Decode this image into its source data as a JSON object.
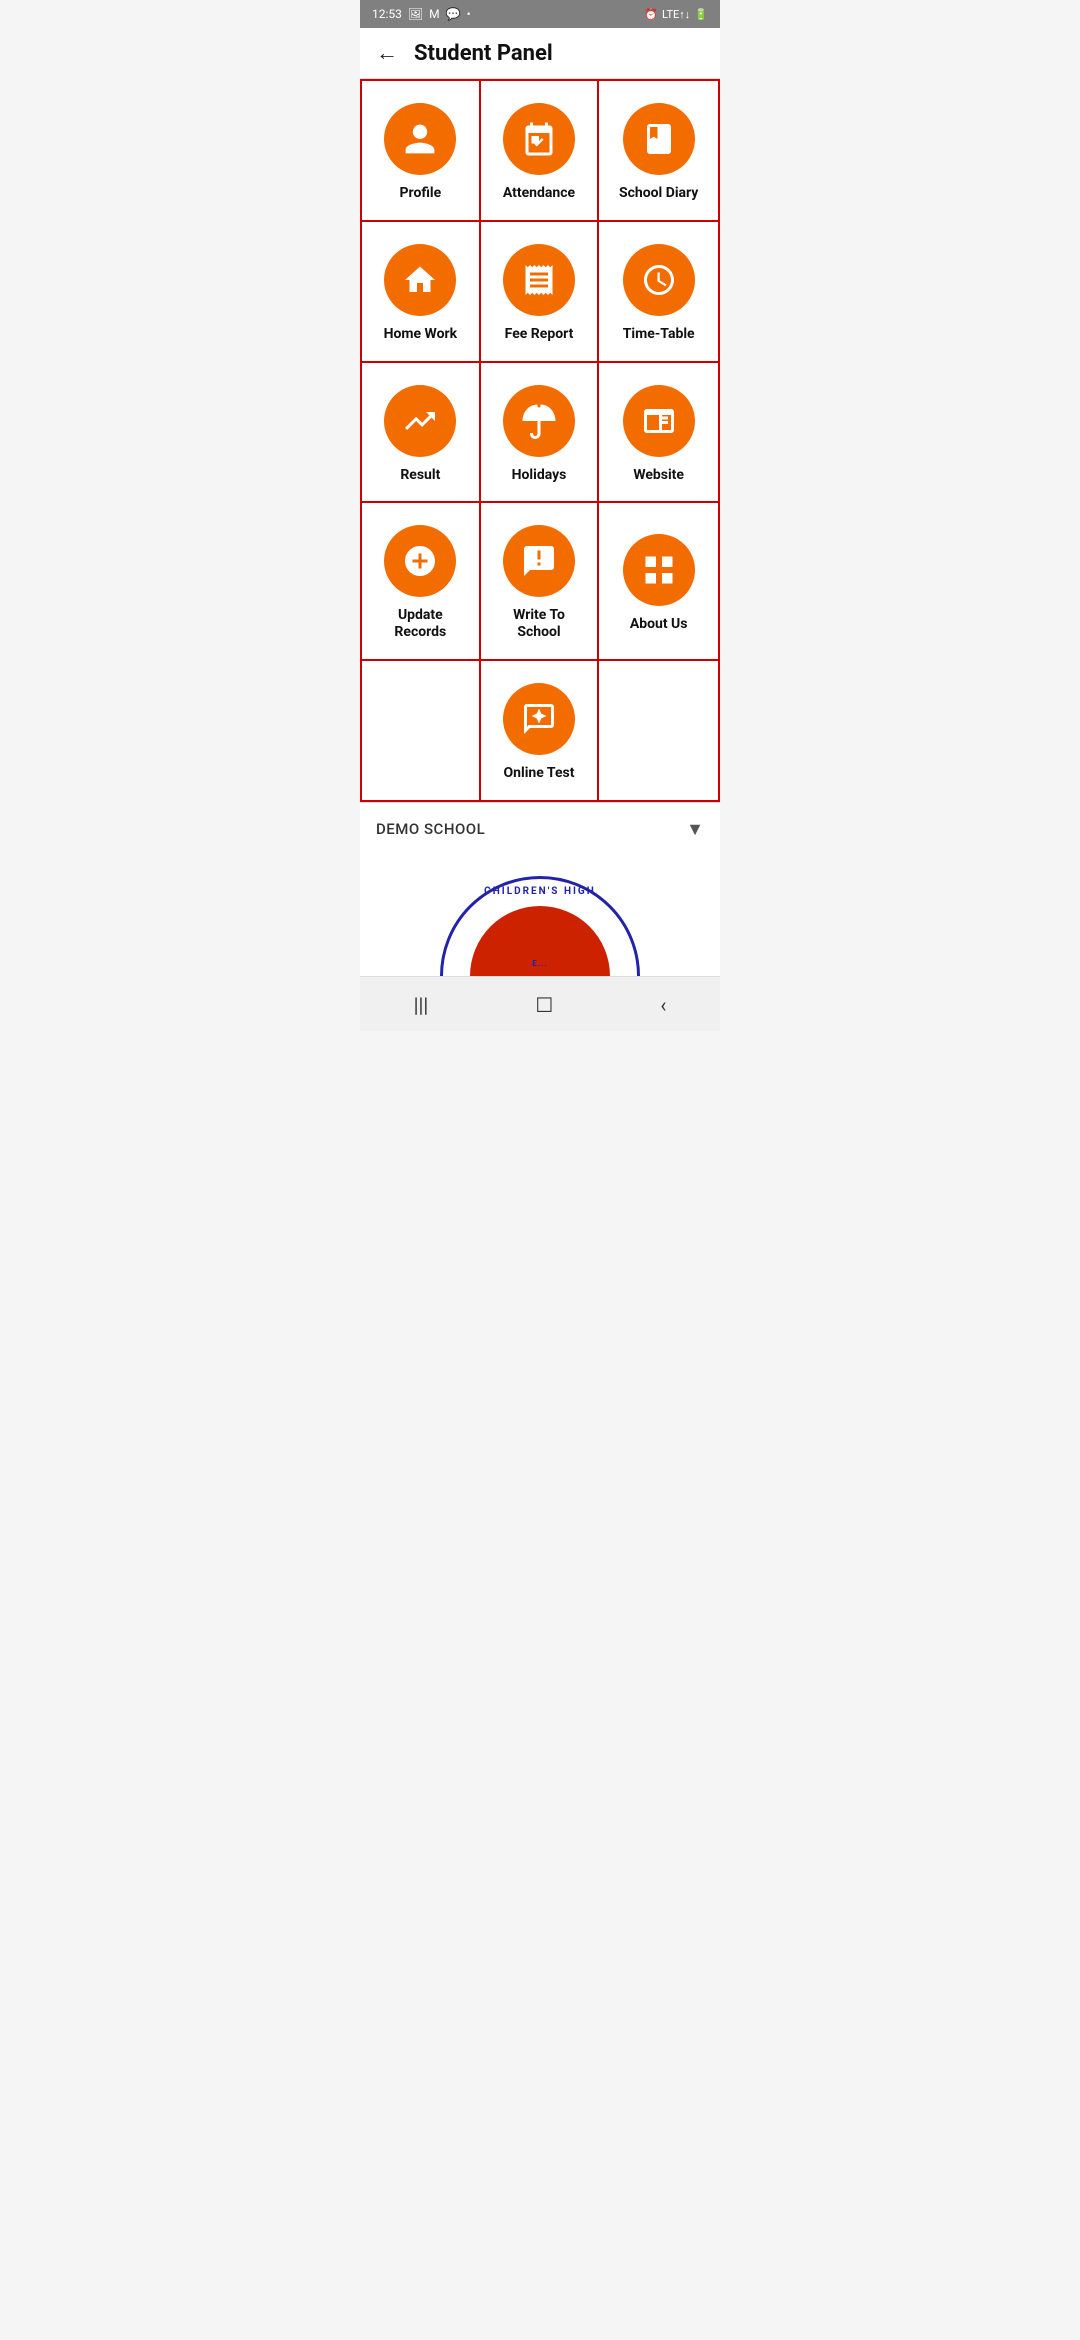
{
  "statusBar": {
    "time": "12:53",
    "icons": [
      "photo",
      "mail",
      "chat",
      "dot"
    ],
    "rightIcons": [
      "alarm",
      "vol-lte",
      "signal",
      "battery"
    ]
  },
  "header": {
    "backLabel": "←",
    "title": "Student Panel"
  },
  "grid": {
    "rows": [
      [
        {
          "id": "profile",
          "label": "Profile",
          "icon": "person"
        },
        {
          "id": "attendance",
          "label": "Attendance",
          "icon": "calendar-check"
        },
        {
          "id": "school-diary",
          "label": "School Diary",
          "icon": "book"
        }
      ],
      [
        {
          "id": "home-work",
          "label": "Home Work",
          "icon": "home"
        },
        {
          "id": "fee-report",
          "label": "Fee Report",
          "icon": "receipt"
        },
        {
          "id": "time-table",
          "label": "Time-Table",
          "icon": "clock"
        }
      ],
      [
        {
          "id": "result",
          "label": "Result",
          "icon": "trending-up"
        },
        {
          "id": "holidays",
          "label": "Holidays",
          "icon": "umbrella"
        },
        {
          "id": "website",
          "label": "Website",
          "icon": "browser"
        }
      ],
      [
        {
          "id": "update-records",
          "label": "Update Records",
          "icon": "plus-circle"
        },
        {
          "id": "write-to-school",
          "label": "Write To School",
          "icon": "message-alert"
        },
        {
          "id": "about-us",
          "label": "About Us",
          "icon": "grid"
        }
      ],
      [
        {
          "id": "empty-1",
          "label": "",
          "icon": ""
        },
        {
          "id": "online-test",
          "label": "Online Test",
          "icon": "chat-bubble"
        },
        {
          "id": "empty-2",
          "label": "",
          "icon": ""
        }
      ]
    ]
  },
  "footer": {
    "schoolName": "DEMO SCHOOL",
    "dropdownArrow": "▼"
  },
  "logo": {
    "text": "CHILDREN'S HIGH"
  },
  "navBar": {
    "items": [
      "|||",
      "☐",
      "<"
    ]
  }
}
